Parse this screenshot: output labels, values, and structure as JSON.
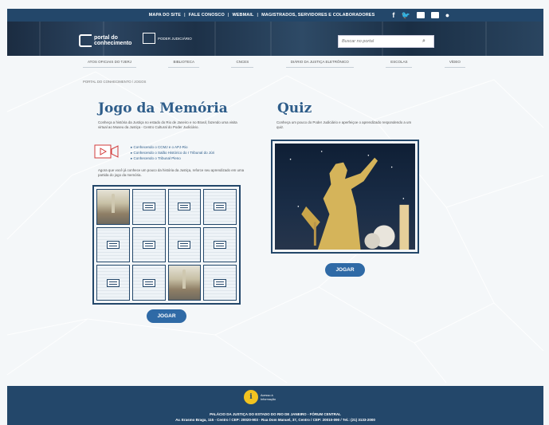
{
  "topbar": {
    "links": [
      "MAPA DO SITE",
      "FALE CONOSCO",
      "WEBMAIL",
      "MAGISTRADOS, SERVIDORES E COLABORADORES"
    ],
    "separator": "|",
    "social_icons": [
      "facebook-icon",
      "twitter-icon",
      "instagram-icon",
      "youtube-icon",
      "flickr-icon"
    ]
  },
  "header": {
    "logo_text": "portal do conhecimento",
    "partner_text": "PODER JUDICIÁRIO",
    "search_placeholder": "Buscar no portal"
  },
  "nav": {
    "items": [
      "ATOS OFICIAIS DO TJERJ",
      "BIBLIOTECA",
      "CNCES",
      "DIÁRIO DA JUSTIÇA ELETRÔNICO",
      "ESCOLAS",
      "VÍDEO"
    ]
  },
  "breadcrumb": "PORTAL DO CONHECIMENTO  /  JOGOS",
  "memory": {
    "title": "Jogo da Memória",
    "desc": "Conheça a história da Justiça no estado do Rio de Janeiro e no Brasil, fazendo uma visita virtual ao Museu da Justiça - Centro Cultural do Poder Judiciário.",
    "links": [
      "Conhecendo o CCMJ e o APJ-Rio",
      "Conhecendo o Salão Histórico do I Tribunal do Júri",
      "Conhecendo o Tribunal Pleno"
    ],
    "prompt": "Agora que você já conhece um pouco da história da Justiça, reforce seu aprendizado em uma partida do jogo da memória.",
    "button": "JOGAR"
  },
  "quiz": {
    "title": "Quiz",
    "desc": "Conheça um pouco do Poder Judiciário e aperfeiçoe o aprendizado respondendo a um quiz.",
    "button": "JOGAR"
  },
  "footer": {
    "badge_text": "Acesso à Informação",
    "line1": "PALÁCIO DA JUSTIÇA DO ESTADO DO RIO DE JANEIRO - FÓRUM CENTRAL",
    "line2": "Av. Erasmo Braga, 115 - Centro / CEP: 20020-903 - Rua Dom Manuel, 37, Centro / CEP: 20010-090 / Tel.: (21) 3133-2000"
  },
  "colors": {
    "primary": "#23476a",
    "title": "#2e5d8a",
    "button": "#2f6aa6",
    "badge": "#f2c320"
  }
}
